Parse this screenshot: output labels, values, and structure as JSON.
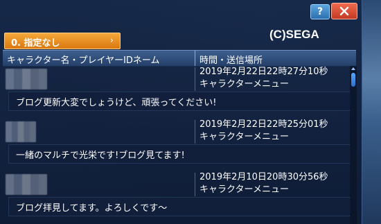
{
  "window": {
    "help_label": "?",
    "filter": {
      "label": "0. 指定なし",
      "chevron": "›"
    },
    "copyright": "(C)SEGA",
    "columns": {
      "name": "キャラクター名・プレイヤーIDネーム",
      "time": "時間・送信場所"
    }
  },
  "entries": [
    {
      "timestamp": "2019年2月22日22時27分10秒",
      "location": "キャラクターメニュー",
      "message": "ブログ更新大変でしょうけど、頑張ってください!"
    },
    {
      "timestamp": "2019年2月22日22時25分01秒",
      "location": "キャラクターメニュー",
      "message": "一緒のマルチで光栄です!ブログ見てます!"
    },
    {
      "timestamp": "2019年2月10日20時30分56秒",
      "location": "キャラクターメニュー",
      "message": "ブログ拝見してます。よろしくです～"
    }
  ],
  "colors": {
    "accent": "#e8891f",
    "close": "#d8472f",
    "help": "#3f8bd0"
  },
  "icons": {
    "help": "help-icon",
    "close": "close-icon",
    "chevron": "chevron-right-icon"
  }
}
